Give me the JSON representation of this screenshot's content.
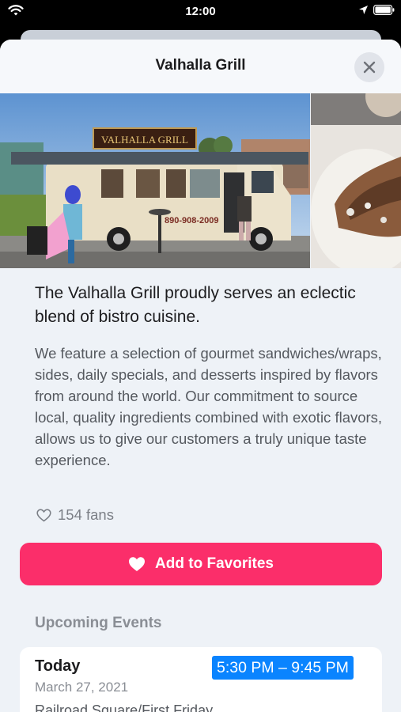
{
  "status_bar": {
    "time": "12:00"
  },
  "sheet": {
    "title": "Valhalla Grill",
    "headline": "The Valhalla Grill proudly serves an eclectic blend of bistro cuisine.",
    "description": "We feature a selection of gourmet sandwiches/wraps, sides, daily specials, and desserts inspired by flavors from around the world. Our commitment to source local, quality ingredients combined with exotic flavors, allows us to give our customers a truly unique taste experience.",
    "fans": "154 fans",
    "favorite_button": "Add to Favorites",
    "truck_sign": "VALHALLA GRILL",
    "truck_phone": "890-908-2009"
  },
  "events": {
    "section_title": "Upcoming Events",
    "items": [
      {
        "day": "Today",
        "date": "March 27, 2021",
        "time": "5:30 PM – 9:45 PM",
        "location": "Railroad Square/First Friday"
      }
    ]
  },
  "colors": {
    "accent_pink": "#fb2e6a",
    "time_highlight": "#0a84ff",
    "sheet_bg": "#eef2f7"
  },
  "icons": {
    "close": "close-icon",
    "heart": "heart-icon",
    "fans": "heart-outline-icon"
  }
}
